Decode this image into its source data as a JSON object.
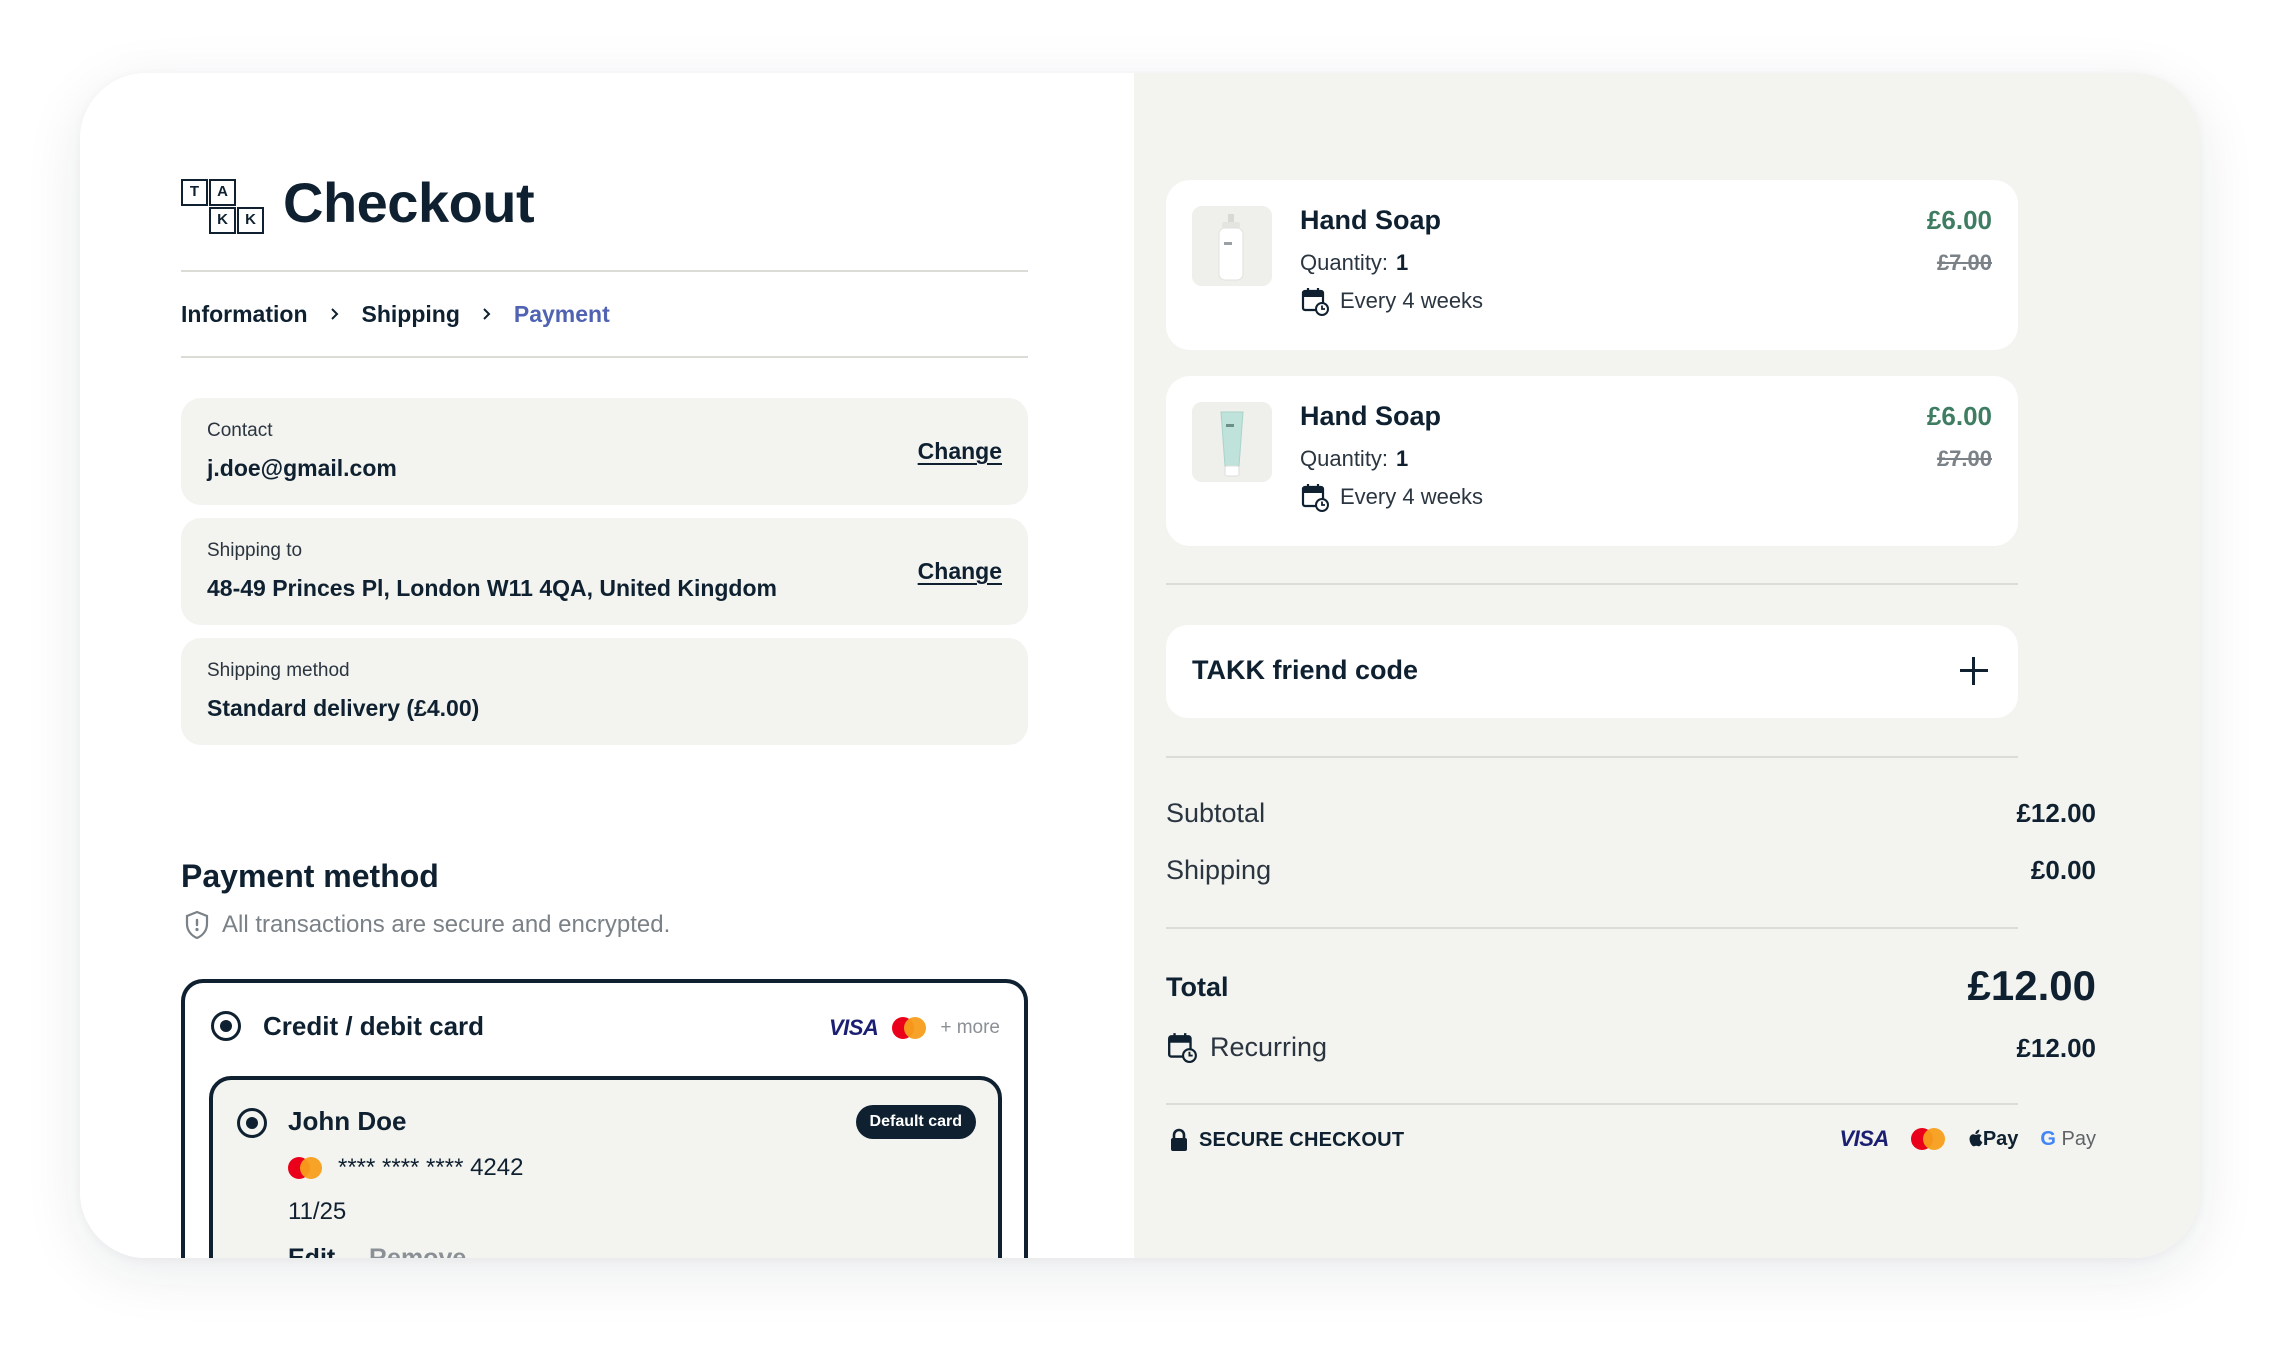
{
  "logo": {
    "letters": [
      "T",
      "A",
      "K",
      "K"
    ]
  },
  "header": {
    "title": "Checkout"
  },
  "breadcrumb": {
    "items": [
      {
        "label": "Information",
        "active": false
      },
      {
        "label": "Shipping",
        "active": false
      },
      {
        "label": "Payment",
        "active": true
      }
    ]
  },
  "summary_boxes": {
    "contact": {
      "label": "Contact",
      "value": "j.doe@gmail.com",
      "action": "Change"
    },
    "shipping_to": {
      "label": "Shipping to",
      "value": "48-49 Princes Pl, London W11 4QA, United Kingdom",
      "action": "Change"
    },
    "shipping_method": {
      "label": "Shipping method",
      "value": "Standard delivery (£4.00)"
    }
  },
  "payment": {
    "title": "Payment method",
    "secure_note": "All transactions are secure and encrypted.",
    "option_label": "Credit / debit card",
    "brands": {
      "visa": "VISA",
      "more": "+ more"
    },
    "saved_card": {
      "name": "John Doe",
      "badge": "Default card",
      "number": "**** **** **** 4242",
      "expiry": "11/25",
      "edit": "Edit",
      "remove": "Remove"
    }
  },
  "order": {
    "items": [
      {
        "name": "Hand Soap",
        "quantity_label": "Quantity:",
        "quantity": "1",
        "frequency": "Every 4 weeks",
        "price": "£6.00",
        "original_price": "£7.00",
        "bottle_color": "#ffffff"
      },
      {
        "name": "Hand Soap",
        "quantity_label": "Quantity:",
        "quantity": "1",
        "frequency": "Every 4 weeks",
        "price": "£6.00",
        "original_price": "£7.00",
        "bottle_color": "#bfe3da"
      }
    ],
    "friend_code": "TAKK friend code",
    "subtotal_label": "Subtotal",
    "subtotal": "£12.00",
    "shipping_label": "Shipping",
    "shipping": "£0.00",
    "total_label": "Total",
    "total": "£12.00",
    "recurring_label": "Recurring",
    "recurring": "£12.00",
    "secure_checkout": "SECURE CHECKOUT",
    "footer_brands": {
      "visa": "VISA",
      "apple_pay": "Pay",
      "google_pay": "Pay"
    }
  },
  "colors": {
    "ink": "#0f2130",
    "accent_link": "#4f63b2",
    "price_green": "#3f7d63",
    "panel": "#f3f3ef"
  }
}
